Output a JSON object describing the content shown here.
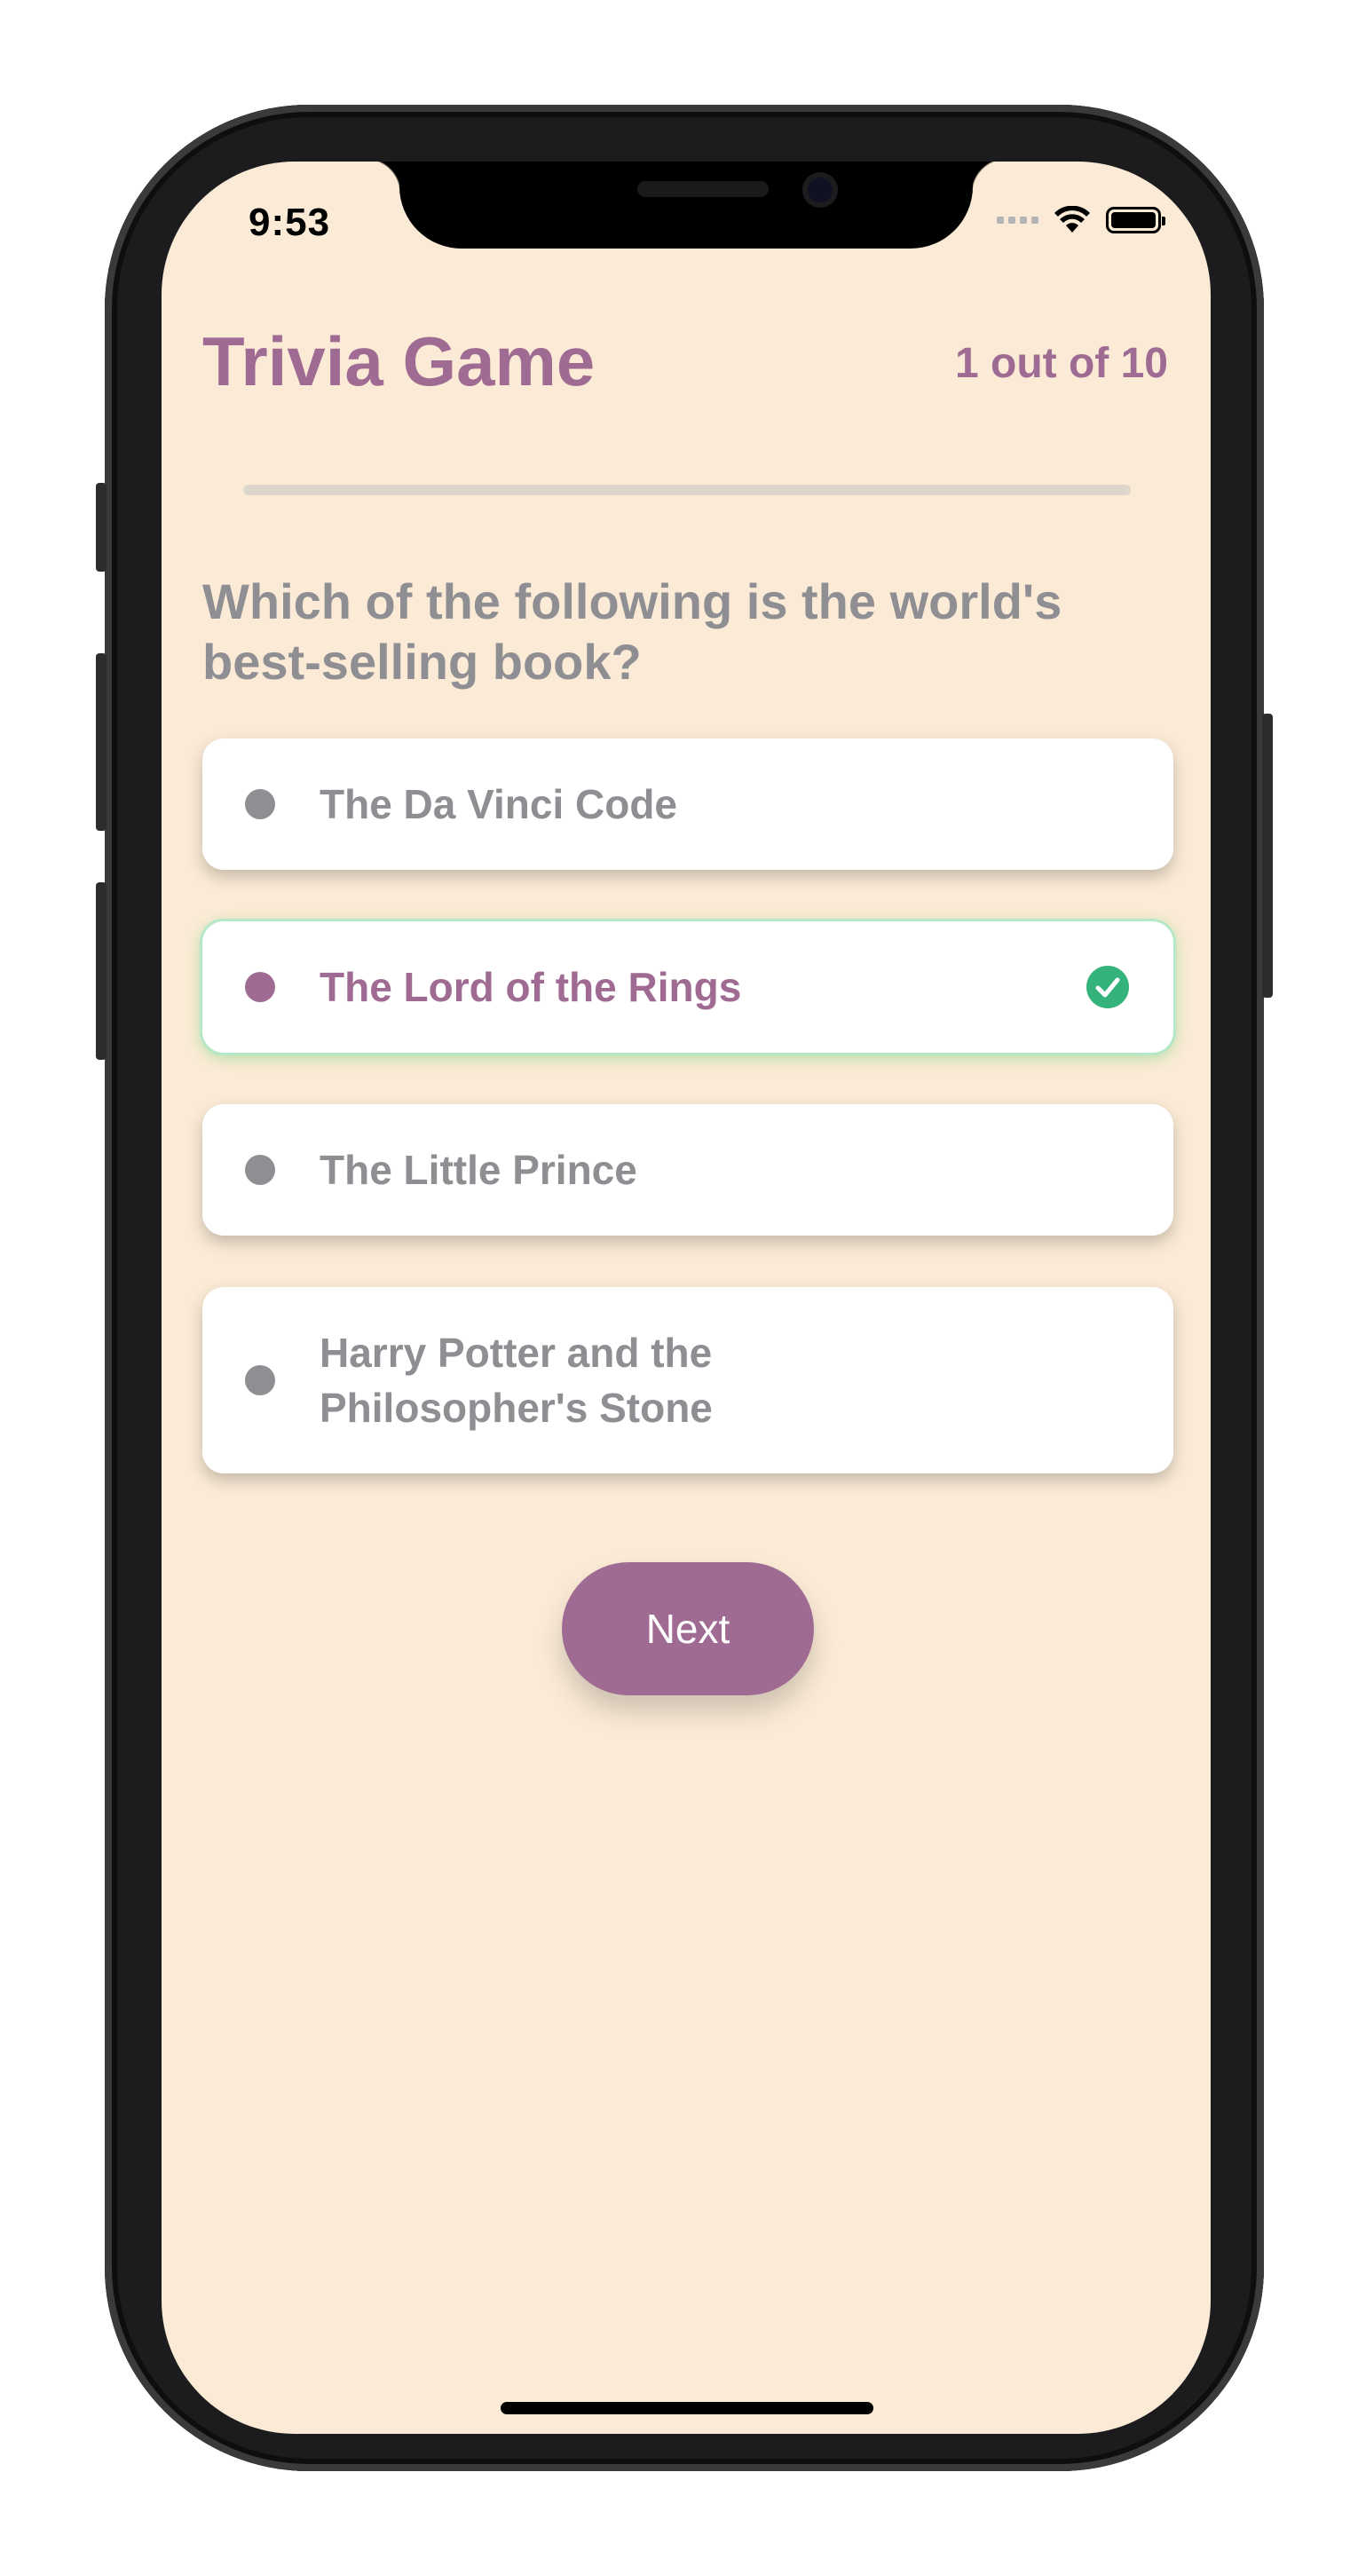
{
  "status_bar": {
    "time": "9:53",
    "icons": [
      "cellular-signal-icon",
      "wifi-icon",
      "battery-icon"
    ]
  },
  "header": {
    "title": "Trivia Game",
    "progress_text": "1 out of 10",
    "progress_fraction": 0.1
  },
  "question": {
    "text": "Which of the following is the world's best-selling book?"
  },
  "answers": [
    {
      "label": "The Da Vinci Code",
      "selected": false
    },
    {
      "label": "The Lord of the Rings",
      "selected": true,
      "correct": true
    },
    {
      "label": "The Little Prince",
      "selected": false
    },
    {
      "label": "Harry Potter and the Philosopher's Stone",
      "selected": false
    }
  ],
  "actions": {
    "next_label": "Next"
  },
  "colors": {
    "background": "#fbebd6",
    "accent": "#9f6b93",
    "muted_text": "#8e8e93",
    "correct_green": "#34b27b"
  }
}
